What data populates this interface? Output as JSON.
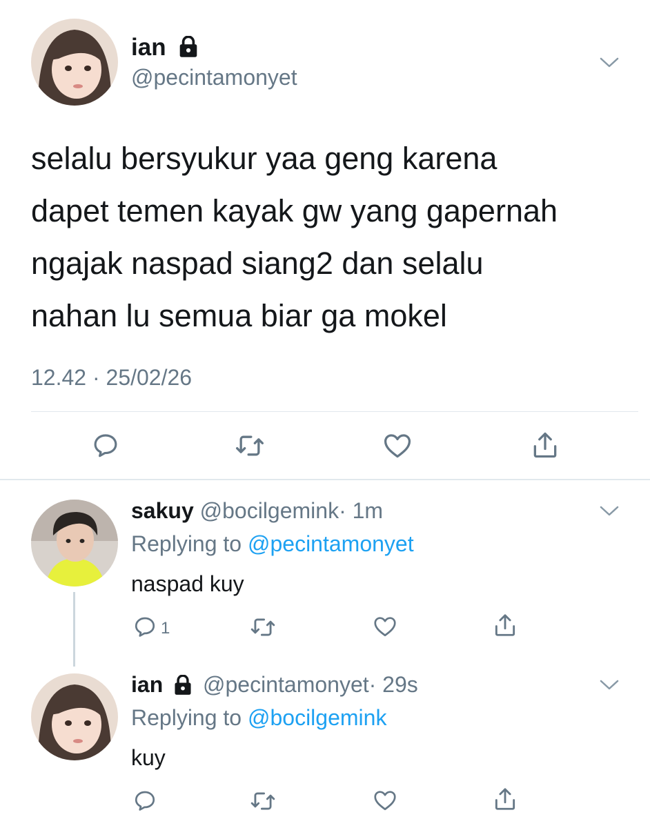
{
  "main_tweet": {
    "name": "ian",
    "handle": "@pecintamonyet",
    "text_lines": [
      "selalu bersyukur yaa geng karena",
      "dapet temen kayak gw yang gapernah",
      "ngajak naspad siang2 dan selalu",
      "nahan lu semua biar ga mokel"
    ],
    "timestamp": "12.42 · 25/02/26"
  },
  "replies": [
    {
      "name": "sakuy",
      "handle": "@bocilgemink",
      "time": "· 1m",
      "replying_prefix": "Replying to ",
      "replying_to": "@pecintamonyet",
      "text": "naspad kuy",
      "reply_count": "1"
    },
    {
      "name": "ian",
      "handle": "@pecintamonyet",
      "time": "· 29s",
      "replying_prefix": "Replying to ",
      "replying_to": "@bocilgemink",
      "text": "kuy"
    }
  ],
  "icons": {
    "lock": "lock-icon",
    "chevron": "chevron-down-icon",
    "reply": "reply-icon",
    "retweet": "retweet-icon",
    "like": "heart-icon",
    "share": "share-icon"
  },
  "colors": {
    "text": "#14171a",
    "secondary": "#657786",
    "link": "#1da1f2",
    "divider": "#e1e8ed"
  }
}
